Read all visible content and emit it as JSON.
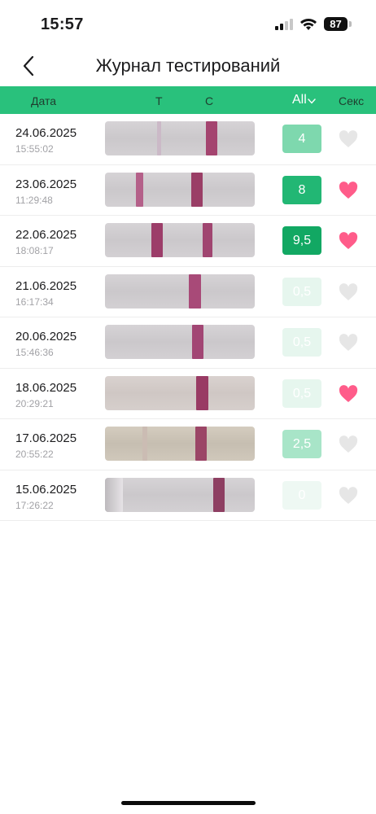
{
  "status_bar": {
    "time": "15:57",
    "battery": "87"
  },
  "header": {
    "title": "Журнал тестирований"
  },
  "table_header": {
    "date": "Дата",
    "t": "Т",
    "c": "С",
    "all": "All",
    "sex": "Секс"
  },
  "colors": {
    "accent": "#29c17c",
    "heart_active": "#ff5c8a",
    "heart_inactive": "#e6e6e6"
  },
  "rows": [
    {
      "date": "24.06.2025",
      "time": "15:55:02",
      "score": "4",
      "score_color": "#7ed8ae",
      "sex": false
    },
    {
      "date": "23.06.2025",
      "time": "11:29:48",
      "score": "8",
      "score_color": "#22b774",
      "sex": true
    },
    {
      "date": "22.06.2025",
      "time": "18:08:17",
      "score": "9,5",
      "score_color": "#12a863",
      "sex": true
    },
    {
      "date": "21.06.2025",
      "time": "16:17:34",
      "score": "0,5",
      "score_color": "#e6f6ee",
      "sex": false
    },
    {
      "date": "20.06.2025",
      "time": "15:46:36",
      "score": "0,5",
      "score_color": "#e6f6ee",
      "sex": false
    },
    {
      "date": "18.06.2025",
      "time": "20:29:21",
      "score": "0,5",
      "score_color": "#e6f6ee",
      "sex": true
    },
    {
      "date": "17.06.2025",
      "time": "20:55:22",
      "score": "2,5",
      "score_color": "#a8e5c8",
      "sex": false
    },
    {
      "date": "15.06.2025",
      "time": "17:26:22",
      "score": "0",
      "score_color": "#eef8f3",
      "sex": false
    }
  ]
}
